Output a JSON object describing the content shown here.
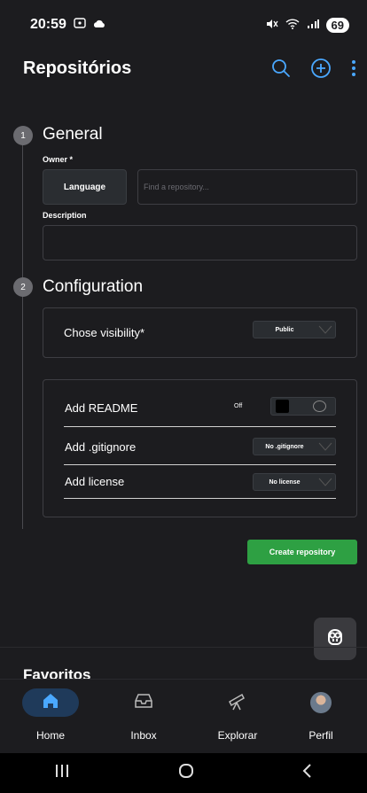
{
  "status_bar": {
    "time": "20:59",
    "battery": "69"
  },
  "app_bar": {
    "title": "Repositórios"
  },
  "steps": {
    "general": {
      "number": "1",
      "title": "General"
    },
    "configuration": {
      "number": "2",
      "title": "Configuration"
    }
  },
  "form": {
    "owner_label": "Owner *",
    "language_button": "Language",
    "repo_placeholder": "Find a repository...",
    "description_label": "Description"
  },
  "visibility": {
    "label": "Chose visibility*",
    "value": "Public"
  },
  "readme": {
    "label": "Add README",
    "toggle_state": "Off"
  },
  "gitignore": {
    "label": "Add .gitignore",
    "value": "No .gitignore"
  },
  "license": {
    "label": "Add license",
    "value": "No license"
  },
  "create_button": "Create repository",
  "favoritos": "Favoritos",
  "bottom_nav": [
    {
      "label": "Home",
      "icon": "home-icon",
      "active": true
    },
    {
      "label": "Inbox",
      "icon": "inbox-icon",
      "active": false
    },
    {
      "label": "Explorar",
      "icon": "telescope-icon",
      "active": false
    },
    {
      "label": "Perfil",
      "icon": "avatar",
      "active": false
    }
  ],
  "colors": {
    "accent": "#4aa8ff",
    "create": "#2ea043",
    "background": "#1c1c1f"
  }
}
